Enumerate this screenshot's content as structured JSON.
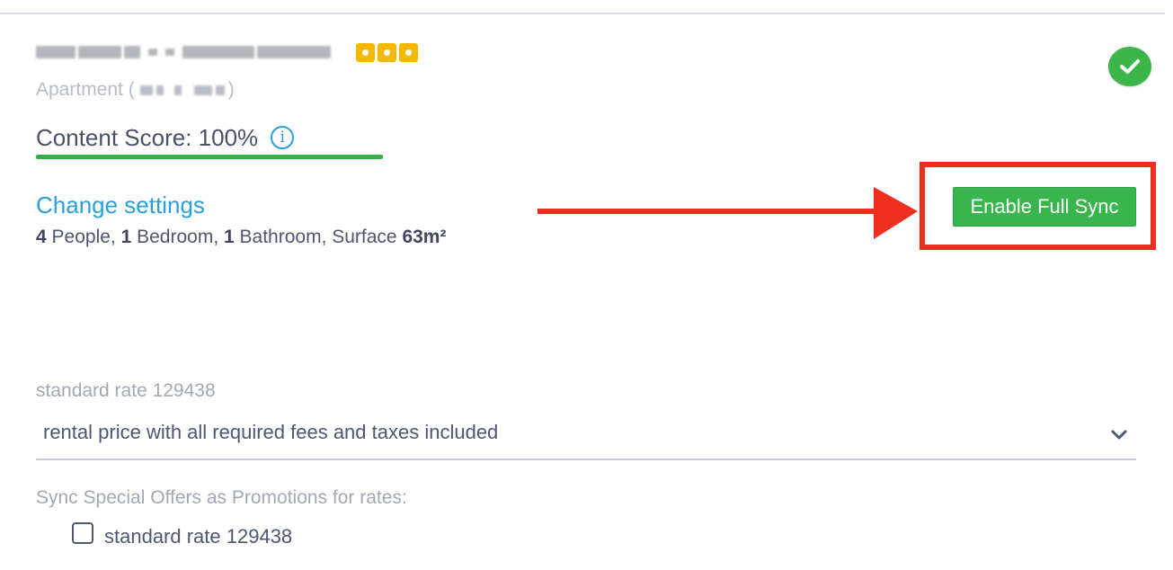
{
  "property": {
    "name_redacted": true,
    "stars": 3,
    "type_prefix": "Apartment (",
    "type_suffix": ")",
    "status_icon": "check-icon",
    "status_color": "#3cb54a"
  },
  "content_score": {
    "label": "Content Score: 100%",
    "value_percent": 100,
    "info_icon": "info-icon",
    "info_glyph": "i",
    "bar_color": "#34b04a"
  },
  "settings": {
    "change_link": "Change settings",
    "capacity": {
      "people_count": "4",
      "people_label": " People, ",
      "bedroom_count": "1",
      "bedroom_label": " Bedroom, ",
      "bathroom_count": "1",
      "bathroom_label": " Bathroom, Surface ",
      "surface": "63m²"
    }
  },
  "sync": {
    "button_label": "Enable Full Sync",
    "button_color": "#38b54d",
    "highlight_color": "#ef2f1e",
    "annotation": "red-arrow"
  },
  "rate": {
    "label": "standard rate 129438",
    "select_value": "rental price with all required fees and taxes included",
    "dropdown_icon": "chevron-down-icon"
  },
  "promotions": {
    "label": "Sync Special Offers as Promotions for rates:",
    "items": [
      {
        "label": "standard rate 129438",
        "checked": false
      }
    ]
  },
  "colors": {
    "link": "#2a9fd8",
    "text": "#4f5770",
    "muted": "#a3a9b3"
  }
}
